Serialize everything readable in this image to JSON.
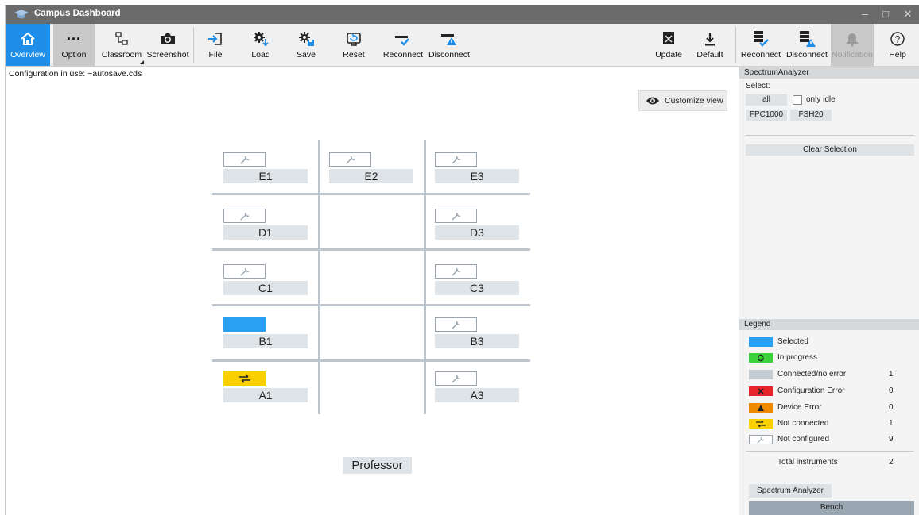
{
  "window": {
    "title": "Campus Dashboard",
    "minimize": "‒",
    "maximize": "□",
    "close": "✕"
  },
  "toolbar": {
    "overview": "Overview",
    "option": "Option",
    "classroom": "Classroom",
    "screenshot": "Screenshot",
    "file": "File",
    "load": "Load",
    "save": "Save",
    "reset": "Reset",
    "reconnect": "Reconnect",
    "disconnect": "Disconnect",
    "update": "Update",
    "default": "Default",
    "reconnect2": "Reconnect",
    "disconnect2": "Disconnect",
    "notification": "Notification",
    "help": "Help"
  },
  "config_line": "Configuration in use:  ~autosave.cds",
  "customize_view": "Customize view",
  "seats": {
    "E1": "E1",
    "E2": "E2",
    "E3": "E3",
    "D1": "D1",
    "D3": "D3",
    "C1": "C1",
    "C3": "C3",
    "B1": "B1",
    "B3": "B3",
    "A1": "A1",
    "A3": "A3"
  },
  "professor": "Professor",
  "panel": {
    "title": "SpectrumAnalyzer",
    "select_label": "Select:",
    "all": "all",
    "only_idle": "only idle",
    "fpc1000": "FPC1000",
    "fsh20": "FSH20",
    "clear_selection": "Clear Selection"
  },
  "legend": {
    "title": "Legend",
    "items": [
      {
        "label": "Selected",
        "count": "",
        "color": "#2aa0f2"
      },
      {
        "label": "In progress",
        "count": "",
        "color": "#3ad13a"
      },
      {
        "label": "Connected/no error",
        "count": "1",
        "color": "#c4cbd1"
      },
      {
        "label": "Configuration Error",
        "count": "0",
        "color": "#e8232a"
      },
      {
        "label": "Device Error",
        "count": "0",
        "color": "#f08a00"
      },
      {
        "label": "Not connected",
        "count": "1",
        "color": "#fad100"
      },
      {
        "label": "Not configured",
        "count": "9",
        "color": "#ffffff"
      }
    ],
    "total_label": "Total instruments",
    "total_count": "2"
  },
  "bottom_tabs": {
    "spectrum": "Spectrum Analyzer",
    "bench": "Bench"
  }
}
